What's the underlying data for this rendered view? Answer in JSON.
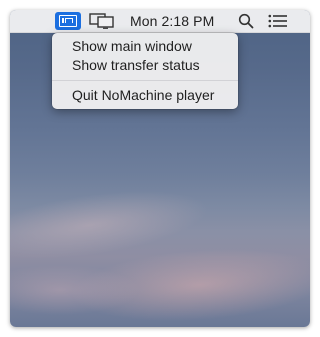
{
  "menubar": {
    "app_icon": "nomachine-icon",
    "display_icon": "display-mirror-icon",
    "clock": "Mon 2:18 PM",
    "search_icon": "search-icon",
    "notification_icon": "notification-center-icon"
  },
  "menu": {
    "items": [
      {
        "label": "Show main window"
      },
      {
        "label": "Show transfer status"
      }
    ],
    "quit": {
      "label": "Quit NoMachine player"
    }
  },
  "colors": {
    "accent": "#1c6fe0",
    "menubar_bg": "#f0f0f2",
    "menu_bg": "#eeeef0",
    "text": "#1f1f1f"
  }
}
